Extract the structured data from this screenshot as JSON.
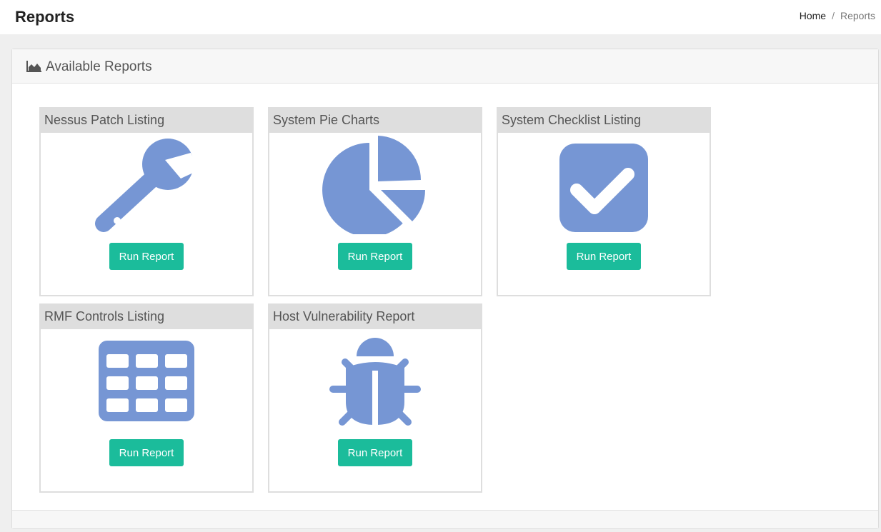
{
  "header": {
    "page_title": "Reports",
    "breadcrumb": {
      "home": "Home",
      "separator": "/",
      "current": "Reports"
    }
  },
  "panel": {
    "icon": "area-chart-icon",
    "title": "Available Reports"
  },
  "colors": {
    "icon_blue": "#7696d4",
    "button_teal": "#1bbc9b",
    "card_header": "#dedede"
  },
  "reports": [
    {
      "title": "Nessus Patch Listing",
      "icon": "wrench-icon",
      "button": "Run Report"
    },
    {
      "title": "System Pie Charts",
      "icon": "pie-chart-icon",
      "button": "Run Report"
    },
    {
      "title": "System Checklist Listing",
      "icon": "checkbox-icon",
      "button": "Run Report"
    },
    {
      "title": "RMF Controls Listing",
      "icon": "table-icon",
      "button": "Run Report"
    },
    {
      "title": "Host Vulnerability Report",
      "icon": "bug-icon",
      "button": "Run Report"
    }
  ]
}
